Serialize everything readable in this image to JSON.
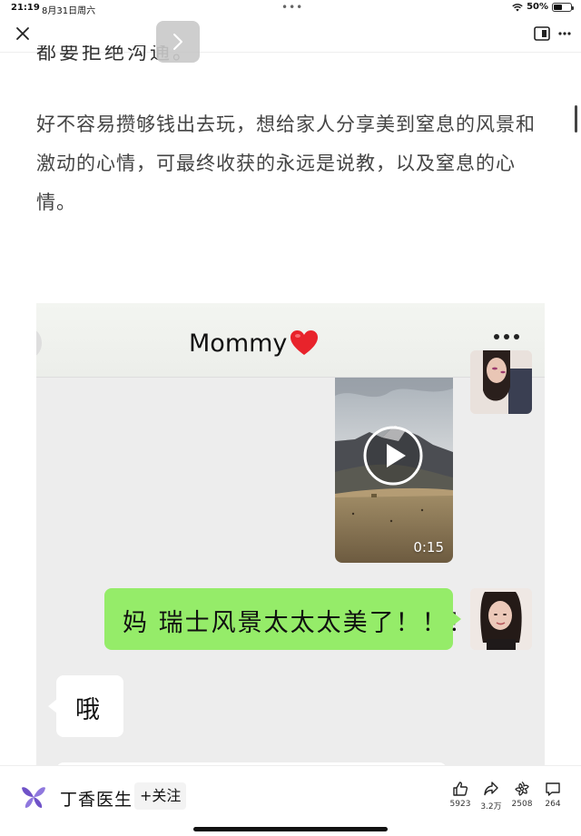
{
  "status_bar": {
    "time": "21:19",
    "date": "8月31日周六",
    "battery": "50%",
    "battery_level": 0.5
  },
  "nav": {
    "cut_text": "都要拒绝沟通。"
  },
  "article": {
    "paragraph": "好不容易攒够钱出去玩，想给家人分享美到窒息的风景和激动的心情，可最终收获的永远是说教，以及窒息的心情。"
  },
  "chat": {
    "title": "Mommy",
    "video_duration": "0:15",
    "messages": [
      {
        "side": "right",
        "text": "妈 瑞士风景太太太美了！！！"
      },
      {
        "side": "left",
        "text": "哦"
      }
    ],
    "colors": {
      "bubble_sent": "#95ec69",
      "background": "#ededed"
    }
  },
  "bottom_bar": {
    "author_name": "丁香医生",
    "follow_label": "+关注",
    "actions": {
      "like_count": "5923",
      "share_count": "3.2万",
      "recommend_count": "2508",
      "comment_count": "264"
    },
    "icons": [
      "thumbs-up-icon",
      "share-arrow-icon",
      "recommend-flower-icon",
      "comment-bubble-icon"
    ]
  }
}
